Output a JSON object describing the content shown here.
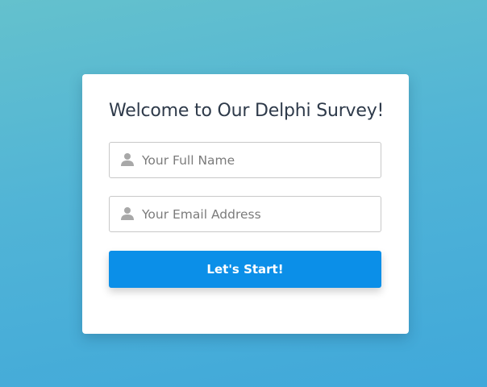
{
  "form": {
    "title": "Welcome to Our Delphi Survey!",
    "name_placeholder": "Your Full Name",
    "email_placeholder": "Your Email Address",
    "submit_label": "Let's Start!"
  },
  "icons": {
    "name_field": "user-icon",
    "email_field": "user-icon"
  },
  "colors": {
    "background_top": "#64c1cd",
    "background_bottom": "#40a8da",
    "button": "#0b8fe8",
    "title_text": "#2e3a4a",
    "icon": "#a8a8a8"
  }
}
